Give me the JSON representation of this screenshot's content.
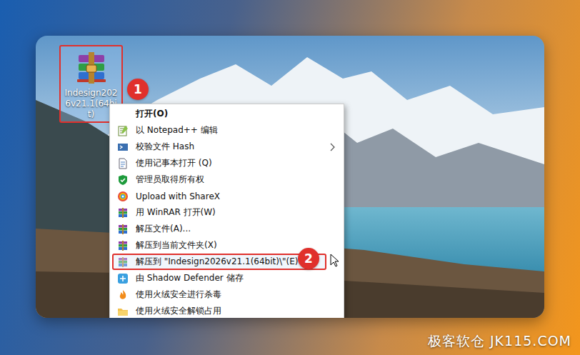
{
  "desktop_icon": {
    "label": "Indesign2026v21.1(64bit)",
    "selected": true,
    "annotated": true
  },
  "context_menu": {
    "items": [
      {
        "label": "打开(O)",
        "kind": "plain",
        "bold": true,
        "submenu": false,
        "annotated": false
      },
      {
        "label": "以 Notepad++ 编辑",
        "kind": "notepad",
        "bold": false,
        "submenu": false,
        "annotated": false
      },
      {
        "label": "校验文件 Hash",
        "kind": "hash",
        "bold": false,
        "submenu": true,
        "annotated": false
      },
      {
        "label": "使用记事本打开 (Q)",
        "kind": "textfile",
        "bold": false,
        "submenu": false,
        "annotated": false
      },
      {
        "label": "管理员取得所有权",
        "kind": "shield",
        "bold": false,
        "submenu": false,
        "annotated": false
      },
      {
        "label": "Upload with ShareX",
        "kind": "sharex",
        "bold": false,
        "submenu": false,
        "annotated": false
      },
      {
        "label": "用 WinRAR 打开(W)",
        "kind": "winrar",
        "bold": false,
        "submenu": false,
        "annotated": false
      },
      {
        "label": "解压文件(A)...",
        "kind": "winrar",
        "bold": false,
        "submenu": false,
        "annotated": false
      },
      {
        "label": "解压到当前文件夹(X)",
        "kind": "winrar",
        "bold": false,
        "submenu": false,
        "annotated": false
      },
      {
        "label": "解压到 \"Indesign2026v21.1(64bit)\\\"(E)",
        "kind": "winrar",
        "bold": false,
        "submenu": false,
        "annotated": true
      },
      {
        "label": "由 Shadow Defender 储存",
        "kind": "defender",
        "bold": false,
        "submenu": false,
        "annotated": false
      },
      {
        "label": "使用火绒安全进行杀毒",
        "kind": "huorong",
        "bold": false,
        "submenu": false,
        "annotated": false
      },
      {
        "label": "使用火绒安全解锁占用",
        "kind": "folder",
        "bold": false,
        "submenu": false,
        "annotated": false
      }
    ]
  },
  "markers": [
    {
      "label": "1"
    },
    {
      "label": "2"
    }
  ],
  "watermark": "极客软仓 JK115.COM"
}
